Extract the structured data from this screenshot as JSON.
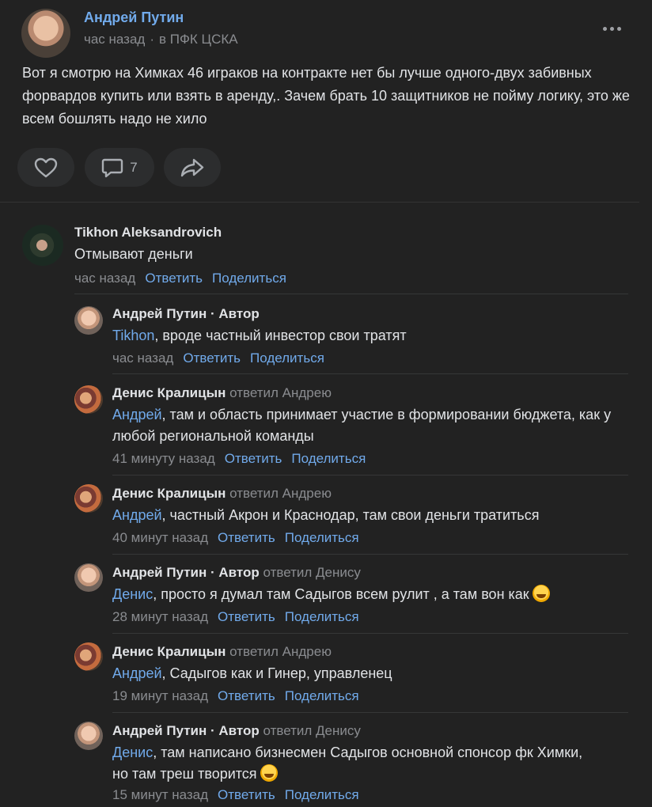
{
  "post": {
    "author": "Андрей Путин",
    "time": "час назад",
    "separator": "·",
    "community": "в ПФК ЦСКА",
    "text": "Вот я смотрю на Химках 46 игракoв на контракте нет бы лучше одного-двух забивных форвардов купить или взять в аренду,. Зачем брать 10 защитников не пойму логику, это же всем бошлять надо не хило",
    "comments_count": "7",
    "icons": {
      "like": "heart-icon",
      "comment": "comment-icon",
      "share": "share-icon",
      "more": "more-dots-icon"
    }
  },
  "comments": [
    {
      "author": "Tikhon Aleksandrovich",
      "replied": "",
      "mention": "",
      "text": "Отмывают деньги",
      "time": "час назад",
      "reply_label": "Ответить",
      "share_label": "Поделиться"
    },
    {
      "author": "Андрей Путин · Автор",
      "replied": "",
      "mention": "Tikhon",
      "text": ", вроде частный инвестор свои тратят",
      "time": "час назад",
      "reply_label": "Ответить",
      "share_label": "Поделиться"
    },
    {
      "author": "Денис Кралицын",
      "replied": "ответил Андрею",
      "mention": "Андрей",
      "text": ", там и область принимает участие в формировании бюджета, как у любой региональной команды",
      "time": "41 минуту назад",
      "reply_label": "Ответить",
      "share_label": "Поделиться"
    },
    {
      "author": "Денис Кралицын",
      "replied": "ответил Андрею",
      "mention": "Андрей",
      "text": ", частный Акрон и Краснодар, там свои деньги тратиться",
      "time": "40 минут назад",
      "reply_label": "Ответить",
      "share_label": "Поделиться"
    },
    {
      "author": "Андрей Путин · Автор",
      "replied": "ответил Денису",
      "mention": "Денис",
      "text": ", просто я думал там Садыгов всем рулит , а там вон как",
      "time": "28 минут назад",
      "reply_label": "Ответить",
      "share_label": "Поделиться"
    },
    {
      "author": "Денис Кралицын",
      "replied": "ответил Андрею",
      "mention": "Андрей",
      "text": ", Садыгов как и Гинер, управленец",
      "time": "19 минут назад",
      "reply_label": "Ответить",
      "share_label": "Поделиться"
    },
    {
      "author": "Андрей Путин · Автор",
      "replied": "ответил Денису",
      "mention": "Денис",
      "text": ", там написано бизнесмен Садыгов основной спонсор фк Химки, но там треш творится",
      "time": "15 минут назад",
      "reply_label": "Ответить",
      "share_label": "Поделиться"
    }
  ],
  "colors": {
    "background": "#222222",
    "link": "#71aaeb",
    "muted": "#8a8c90",
    "text": "#e1e3e6"
  }
}
